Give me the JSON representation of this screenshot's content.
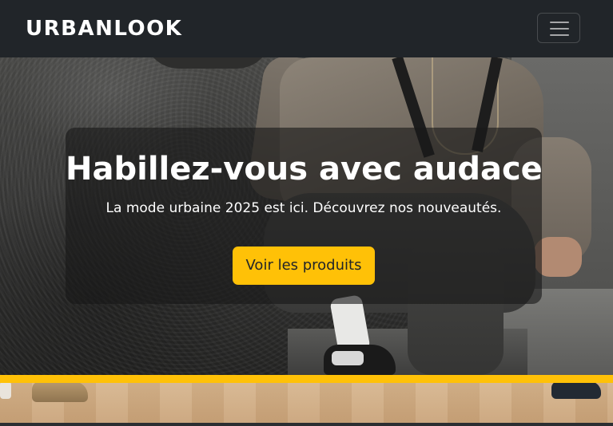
{
  "navbar": {
    "brand": "URBANLOOK",
    "toggler_icon": "hamburger-menu-icon"
  },
  "hero": {
    "title": "Habillez-vous avec audace",
    "subtitle": "La mode urbaine 2025 est ici. Découvrez nos nouveautés.",
    "cta_label": "Voir les produits"
  },
  "colors": {
    "navbar_bg": "#212529",
    "accent": "#ffc107",
    "text_light": "#ffffff",
    "text_dark": "#212529"
  }
}
